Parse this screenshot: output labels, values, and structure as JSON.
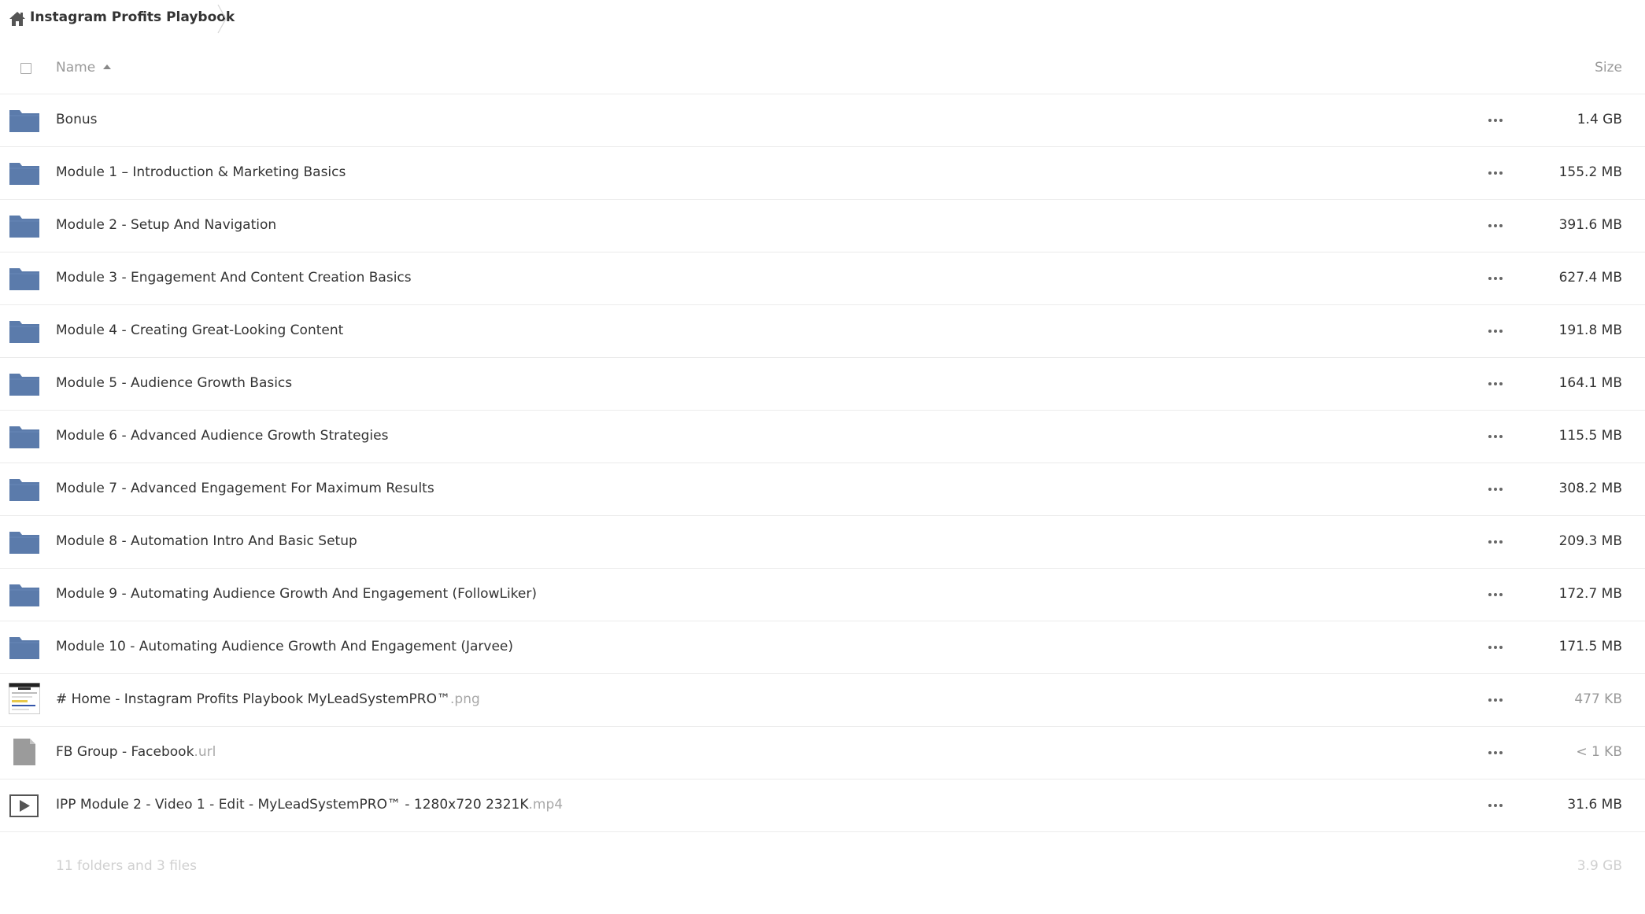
{
  "breadcrumb": {
    "home_label": "Instagram Profits Playbook"
  },
  "header": {
    "name_label": "Name",
    "size_label": "Size",
    "sort": "ascending"
  },
  "colors": {
    "folder": "#5b7bab",
    "file_generic": "#9b9b9b",
    "text": "#333333",
    "muted": "#999999"
  },
  "files": [
    {
      "type": "folder",
      "name": "Bonus",
      "ext": "",
      "size": "1.4 GB",
      "icon": "folder-icon"
    },
    {
      "type": "folder",
      "name": "Module 1 – Introduction & Marketing Basics",
      "ext": "",
      "size": "155.2 MB",
      "icon": "folder-icon"
    },
    {
      "type": "folder",
      "name": "Module 2 - Setup And Navigation",
      "ext": "",
      "size": "391.6 MB",
      "icon": "folder-icon"
    },
    {
      "type": "folder",
      "name": "Module 3 - Engagement And Content Creation Basics",
      "ext": "",
      "size": "627.4 MB",
      "icon": "folder-icon"
    },
    {
      "type": "folder",
      "name": "Module 4 - Creating Great-Looking Content",
      "ext": "",
      "size": "191.8 MB",
      "icon": "folder-icon"
    },
    {
      "type": "folder",
      "name": "Module 5 - Audience Growth Basics",
      "ext": "",
      "size": "164.1 MB",
      "icon": "folder-icon"
    },
    {
      "type": "folder",
      "name": "Module 6 - Advanced Audience Growth Strategies",
      "ext": "",
      "size": "115.5 MB",
      "icon": "folder-icon"
    },
    {
      "type": "folder",
      "name": "Module 7 - Advanced Engagement For Maximum Results",
      "ext": "",
      "size": "308.2 MB",
      "icon": "folder-icon"
    },
    {
      "type": "folder",
      "name": "Module 8 - Automation Intro And Basic Setup",
      "ext": "",
      "size": "209.3 MB",
      "icon": "folder-icon"
    },
    {
      "type": "folder",
      "name": "Module 9 - Automating Audience Growth And Engagement (FollowLiker)",
      "ext": "",
      "size": "172.7 MB",
      "icon": "folder-icon"
    },
    {
      "type": "folder",
      "name": "Module 10 - Automating Audience Growth And Engagement (Jarvee)",
      "ext": "",
      "size": "171.5 MB",
      "icon": "folder-icon"
    },
    {
      "type": "image",
      "name": "# Home - Instagram Profits Playbook MyLeadSystemPRO™",
      "ext": ".png",
      "size": "477 KB",
      "icon": "image-thumbnail-icon",
      "muted_size": true
    },
    {
      "type": "file",
      "name": "FB Group - Facebook",
      "ext": ".url",
      "size": "< 1 KB",
      "icon": "document-icon",
      "muted_size": true
    },
    {
      "type": "video",
      "name": "IPP Module 2 - Video 1 - Edit - MyLeadSystemPRO™ - 1280x720 2321K",
      "ext": ".mp4",
      "size": "31.6 MB",
      "icon": "video-icon"
    }
  ],
  "summary": {
    "count_text": "11 folders and 3 files",
    "total_size": "3.9 GB"
  }
}
